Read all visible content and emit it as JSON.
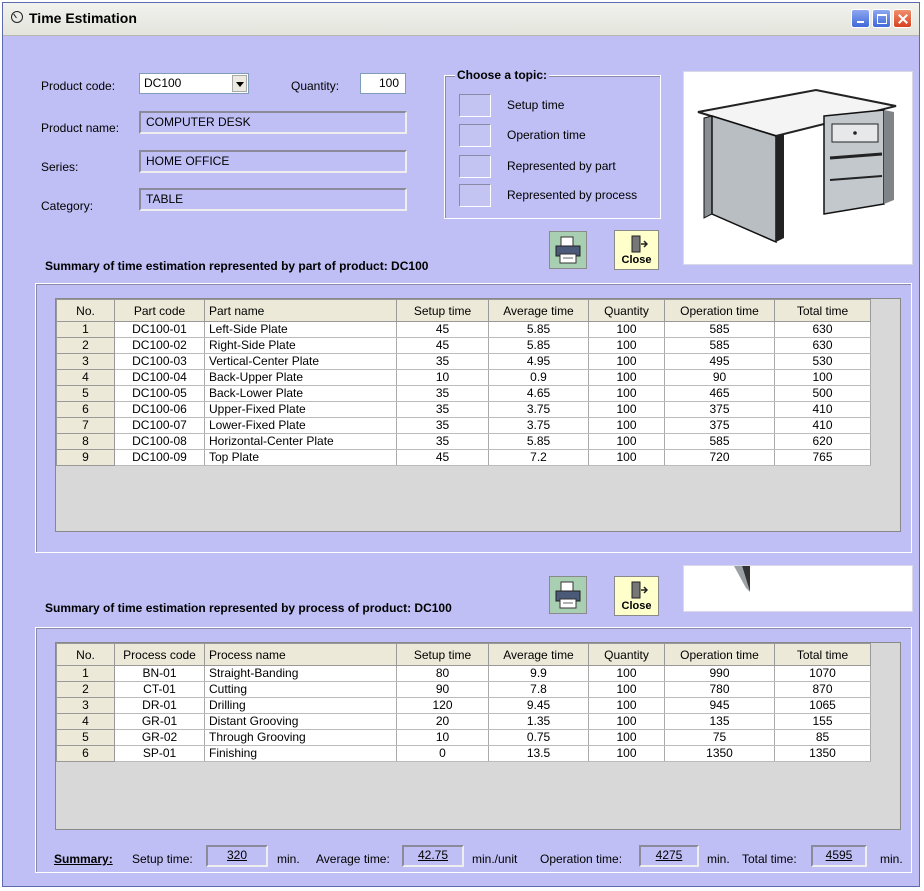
{
  "window": {
    "title": "Time Estimation"
  },
  "form": {
    "product_code_label": "Product code:",
    "product_code": "DC100",
    "quantity_label": "Quantity:",
    "quantity": "100",
    "product_name_label": "Product name:",
    "product_name": "COMPUTER DESK",
    "series_label": "Series:",
    "series": "HOME OFFICE",
    "category_label": "Category:",
    "category": "TABLE"
  },
  "topic": {
    "title": "Choose a topic:",
    "options": [
      "Setup time",
      "Operation time",
      "Represented by part",
      "Represented by process"
    ]
  },
  "buttons": {
    "close_label": "Close"
  },
  "parts": {
    "title": "Summary of time estimation represented by part of product:  DC100",
    "columns": [
      "No.",
      "Part code",
      "Part name",
      "Setup time",
      "Average time",
      "Quantity",
      "Operation time",
      "Total time"
    ],
    "rows": [
      [
        "1",
        "DC100-01",
        "Left-Side Plate",
        "45",
        "5.85",
        "100",
        "585",
        "630"
      ],
      [
        "2",
        "DC100-02",
        "Right-Side Plate",
        "45",
        "5.85",
        "100",
        "585",
        "630"
      ],
      [
        "3",
        "DC100-03",
        "Vertical-Center Plate",
        "35",
        "4.95",
        "100",
        "495",
        "530"
      ],
      [
        "4",
        "DC100-04",
        "Back-Upper Plate",
        "10",
        "0.9",
        "100",
        "90",
        "100"
      ],
      [
        "5",
        "DC100-05",
        "Back-Lower Plate",
        "35",
        "4.65",
        "100",
        "465",
        "500"
      ],
      [
        "6",
        "DC100-06",
        "Upper-Fixed Plate",
        "35",
        "3.75",
        "100",
        "375",
        "410"
      ],
      [
        "7",
        "DC100-07",
        "Lower-Fixed Plate",
        "35",
        "3.75",
        "100",
        "375",
        "410"
      ],
      [
        "8",
        "DC100-08",
        "Horizontal-Center Plate",
        "35",
        "5.85",
        "100",
        "585",
        "620"
      ],
      [
        "9",
        "DC100-09",
        "Top Plate",
        "45",
        "7.2",
        "100",
        "720",
        "765"
      ]
    ]
  },
  "processes": {
    "title": "Summary of time estimation represented by process of product:  DC100",
    "columns": [
      "No.",
      "Process code",
      "Process name",
      "Setup time",
      "Average time",
      "Quantity",
      "Operation time",
      "Total time"
    ],
    "rows": [
      [
        "1",
        "BN-01",
        "Straight-Banding",
        "80",
        "9.9",
        "100",
        "990",
        "1070"
      ],
      [
        "2",
        "CT-01",
        "Cutting",
        "90",
        "7.8",
        "100",
        "780",
        "870"
      ],
      [
        "3",
        "DR-01",
        "Drilling",
        "120",
        "9.45",
        "100",
        "945",
        "1065"
      ],
      [
        "4",
        "GR-01",
        "Distant Grooving",
        "20",
        "1.35",
        "100",
        "135",
        "155"
      ],
      [
        "5",
        "GR-02",
        "Through Grooving",
        "10",
        "0.75",
        "100",
        "75",
        "85"
      ],
      [
        "6",
        "SP-01",
        "Finishing",
        "0",
        "13.5",
        "100",
        "1350",
        "1350"
      ]
    ]
  },
  "summary": {
    "label": "Summary:",
    "setup_label": "Setup time:",
    "setup_value": "320",
    "setup_unit": "min.",
    "avg_label": "Average time:",
    "avg_value": "42.75",
    "avg_unit": "min./unit",
    "op_label": "Operation time:",
    "op_value": "4275",
    "op_unit": "min.",
    "total_label": "Total time:",
    "total_value": "4595",
    "total_unit": "min."
  },
  "colors": {
    "window_bg": "#bfbff5",
    "close_button_bg": "#ffffcc",
    "print_button_bg": "#a9cfb3"
  }
}
